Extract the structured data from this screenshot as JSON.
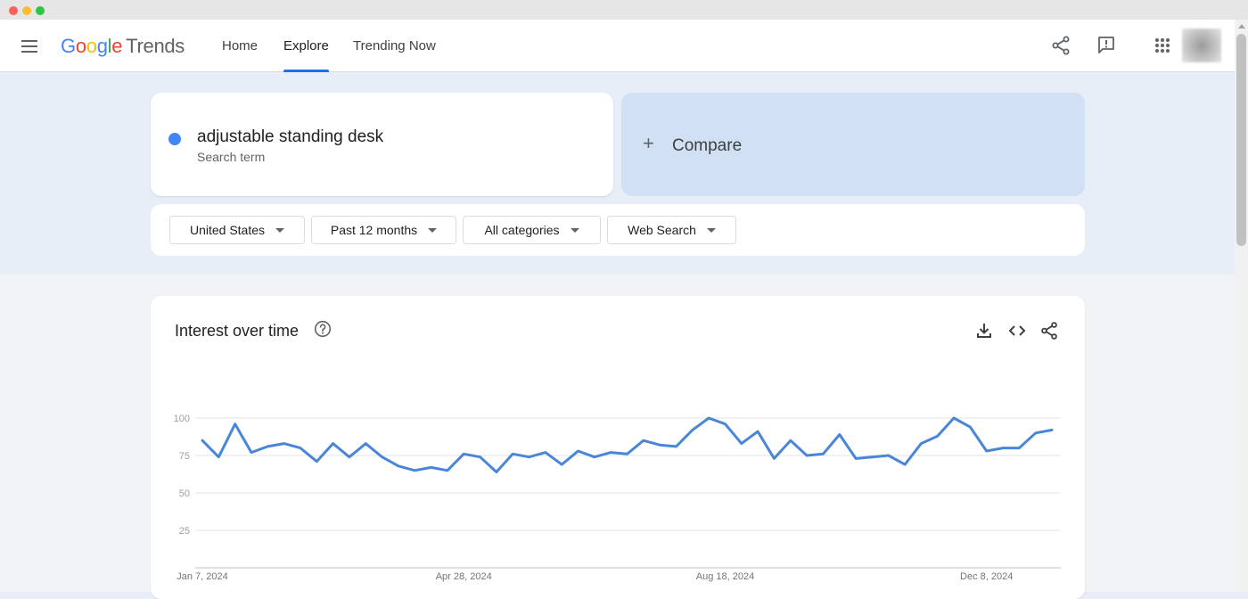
{
  "header": {
    "logo_letters": [
      "G",
      "o",
      "o",
      "g",
      "l",
      "e"
    ],
    "logo_product": "Trends",
    "nav": [
      {
        "label": "Home",
        "active": false
      },
      {
        "label": "Explore",
        "active": true
      },
      {
        "label": "Trending Now",
        "active": false
      }
    ],
    "icons": [
      "share-icon",
      "feedback-icon",
      "apps-grid-icon",
      "avatar"
    ]
  },
  "search_term": {
    "label": "adjustable standing desk",
    "sublabel": "Search term",
    "color": "#4285f4"
  },
  "compare": {
    "label": "Compare"
  },
  "filters": [
    {
      "label": "United States"
    },
    {
      "label": "Past 12 months"
    },
    {
      "label": "All categories"
    },
    {
      "label": "Web Search"
    }
  ],
  "interest_card": {
    "title": "Interest over time",
    "actions": [
      "download-icon",
      "embed-code-icon",
      "share-icon"
    ]
  },
  "colors": {
    "accent": "#1a73e8",
    "series": "#4a86d8",
    "hero_bg": "#e8eef8",
    "compare_bg": "#d2e0f4"
  },
  "chart_data": {
    "type": "line",
    "title": "",
    "xlabel": "",
    "ylabel": "",
    "ylim": [
      0,
      100
    ],
    "y_ticks": [
      "100",
      "75",
      "50",
      "25"
    ],
    "x_ticks": [
      "Jan 7, 2024",
      "Apr 28, 2024",
      "Aug 18, 2024",
      "Dec 8, 2024"
    ],
    "grid": true,
    "series": [
      {
        "values": [
          85,
          74,
          96,
          77,
          81,
          83,
          80,
          71,
          83,
          74,
          83,
          74,
          68,
          65,
          67,
          65,
          76,
          74,
          64,
          76,
          74,
          77,
          69,
          78,
          74,
          77,
          76,
          85,
          82,
          81,
          92,
          100,
          96,
          83,
          91,
          73,
          85,
          75,
          76,
          89,
          73,
          74,
          75,
          69,
          83,
          88,
          100,
          94,
          78,
          80,
          80,
          90,
          92
        ]
      }
    ]
  }
}
